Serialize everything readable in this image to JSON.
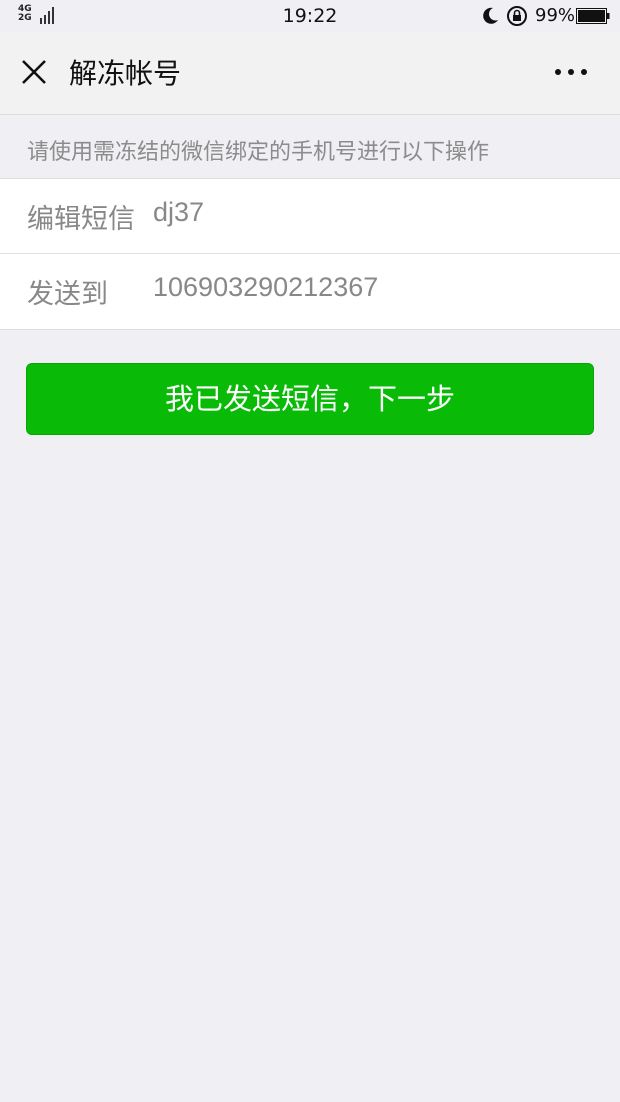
{
  "status_bar": {
    "network_top": "4G",
    "network_bottom": "2G",
    "time": "19:22",
    "battery_text": "99%"
  },
  "navbar": {
    "title": "解冻帐号"
  },
  "hint": "请使用需冻结的微信绑定的手机号进行以下操作",
  "form": {
    "rows": [
      {
        "label": "编辑短信",
        "value": "dj37"
      },
      {
        "label": "发送到",
        "value": "106903290212367"
      }
    ]
  },
  "primary_button": "我已发送短信，下一步",
  "colors": {
    "background": "#efeff4",
    "primary_green": "#09bb07"
  }
}
